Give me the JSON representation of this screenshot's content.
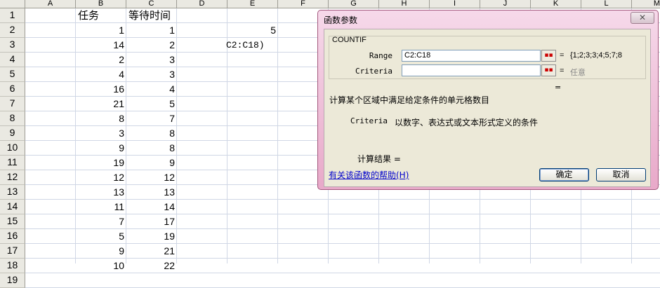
{
  "columns": [
    "A",
    "B",
    "C",
    "D",
    "E",
    "F",
    "G",
    "H",
    "I",
    "J",
    "K",
    "L",
    "M"
  ],
  "rows": [
    "1",
    "2",
    "3",
    "4",
    "5",
    "6",
    "7",
    "8",
    "9",
    "10",
    "11",
    "12",
    "13",
    "14",
    "15",
    "16",
    "17",
    "18",
    "19"
  ],
  "cells": {
    "B1": "任务",
    "C1": "等待时间",
    "B": [
      "1",
      "14",
      "2",
      "4",
      "16",
      "21",
      "8",
      "3",
      "9",
      "19",
      "12",
      "13",
      "11",
      "7",
      "5",
      "9",
      "10"
    ],
    "C": [
      "1",
      "2",
      "3",
      "3",
      "4",
      "5",
      "7",
      "8",
      "8",
      "9",
      "12",
      "13",
      "14",
      "17",
      "19",
      "21",
      "22"
    ],
    "E2": "5",
    "D3_overflow": "C2:C18)"
  },
  "dialog": {
    "title": "函数参数",
    "close_label": "✕",
    "function_name": "COUNTIF",
    "args": [
      {
        "label": "Range",
        "value": "C2:C18",
        "eq": "=",
        "result": "{1;2;3;3;4;5;7;8"
      },
      {
        "label": "Criteria",
        "value": "",
        "eq": "=",
        "result": "任意"
      }
    ],
    "result_eq": "=",
    "description": "计算某个区域中满足给定条件的单元格数目",
    "arg_desc_name": "Criteria",
    "arg_desc_text": "以数字、表达式或文本形式定义的条件",
    "calc_result": "计算结果 =",
    "help_link": "有关该函数的帮助(H)",
    "ok_label": "确定",
    "cancel_label": "取消"
  },
  "colors": {
    "annotation": "#1a2fd0",
    "header_bg": "#eae9e2",
    "dialog_pink": "#e8a9c9"
  }
}
